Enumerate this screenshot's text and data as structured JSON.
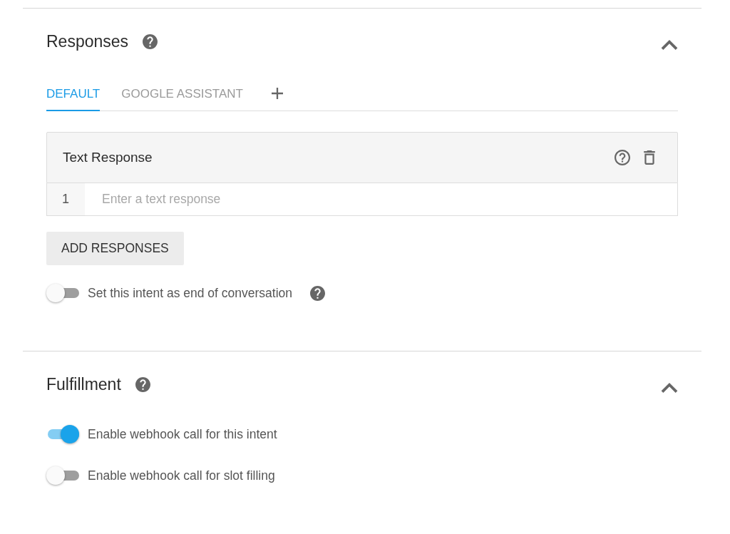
{
  "sections": [
    {
      "title": "Responses",
      "help": true,
      "expanded": true,
      "tabs": [
        {
          "label": "DEFAULT",
          "selected": true
        },
        {
          "label": "GOOGLE ASSISTANT",
          "selected": false
        }
      ],
      "response_card": {
        "title": "Text Response",
        "rows": [
          {
            "number": "1",
            "placeholder": "Enter a text response"
          }
        ]
      },
      "add_button": "ADD RESPONSES",
      "toggles": [
        {
          "label": "Set this intent as end of conversation",
          "on": false,
          "help": true
        }
      ]
    },
    {
      "title": "Fulfillment",
      "help": true,
      "expanded": true,
      "toggles": [
        {
          "label": "Enable webhook call for this intent",
          "on": true
        },
        {
          "label": "Enable webhook call for slot filling",
          "on": false
        }
      ]
    }
  ]
}
